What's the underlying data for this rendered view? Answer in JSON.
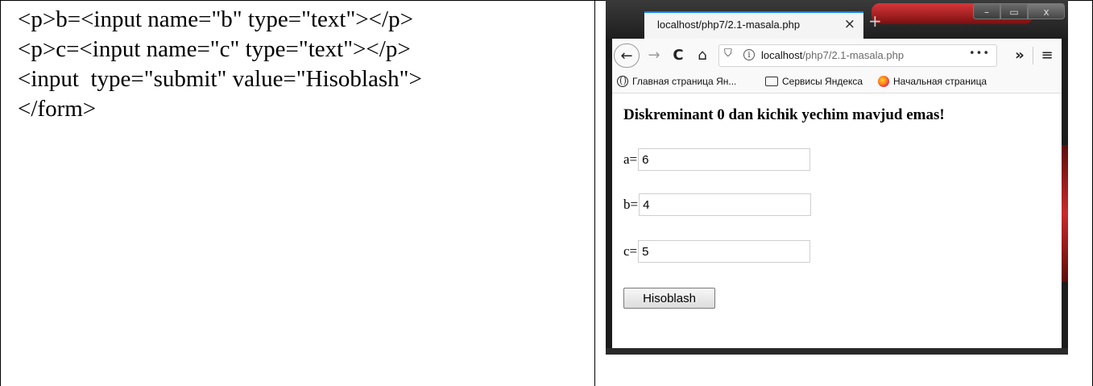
{
  "document": {
    "code_lines": [
      "<p>b=<input name=\"b\" type=\"text\"></p>",
      "<p>c=<input name=\"c\" type=\"text\"></p>",
      "<input  type=\"submit\" value=\"Hisoblash\">",
      "</form>"
    ]
  },
  "browser": {
    "tab": {
      "title": "localhost/php7/2.1-masala.php",
      "close_glyph": "×"
    },
    "new_tab_glyph": "+",
    "window_controls": {
      "minimize": "–",
      "maximize": "▭",
      "close": "x"
    },
    "nav": {
      "back_icon": "←",
      "forward_icon": "→",
      "reload_icon": "C",
      "home_icon": "⌂",
      "url_host": "localhost",
      "url_path": "/php7/2.1-masala.php",
      "more_icon": "•••",
      "overflow_icon": "»",
      "menu_icon": "≡",
      "shield_icon": "⛉",
      "info_icon": "i"
    },
    "bookmarks": [
      {
        "icon": "globe-icon",
        "label": "Главная страница Ян..."
      },
      {
        "icon": "folder-icon",
        "label": "Сервисы Яндекса"
      },
      {
        "icon": "firefox-icon",
        "label": "Начальная страница"
      }
    ],
    "page": {
      "message": "Diskreminant 0 dan kichik yechim mavjud emas!",
      "fields": [
        {
          "label": "a=",
          "value": "6"
        },
        {
          "label": "b=",
          "value": "4"
        },
        {
          "label": "c=",
          "value": "5"
        }
      ],
      "submit_label": "Hisoblash"
    }
  }
}
